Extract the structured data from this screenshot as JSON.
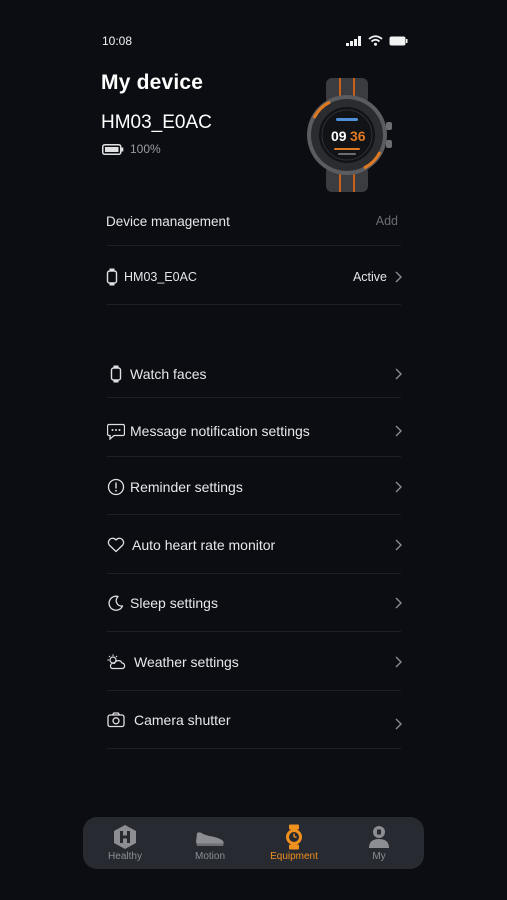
{
  "status_bar": {
    "time": "10:08"
  },
  "header": {
    "title": "My device",
    "device_name": "HM03_E0AC",
    "battery": "100%"
  },
  "device_management": {
    "title": "Device management",
    "add_label": "Add",
    "device": {
      "name": "HM03_E0AC",
      "status": "Active"
    }
  },
  "menu": [
    {
      "label": "Watch faces",
      "icon": "watch-icon"
    },
    {
      "label": "Message notification settings",
      "icon": "message-icon"
    },
    {
      "label": "Reminder settings",
      "icon": "alert-icon"
    },
    {
      "label": "Auto heart rate monitor",
      "icon": "heart-icon"
    },
    {
      "label": "Sleep settings",
      "icon": "moon-icon"
    },
    {
      "label": "Weather settings",
      "icon": "weather-icon"
    },
    {
      "label": "Camera shutter",
      "icon": "camera-icon"
    }
  ],
  "nav": [
    {
      "label": "Healthy",
      "icon": "healthy-icon",
      "active": false
    },
    {
      "label": "Motion",
      "icon": "shoe-icon",
      "active": false
    },
    {
      "label": "Equipment",
      "icon": "watch-icon",
      "active": true
    },
    {
      "label": "My",
      "icon": "profile-icon",
      "active": false
    }
  ],
  "colors": {
    "background": "#0b0d12",
    "accent": "#f0901e",
    "nav_background": "#272a30"
  }
}
